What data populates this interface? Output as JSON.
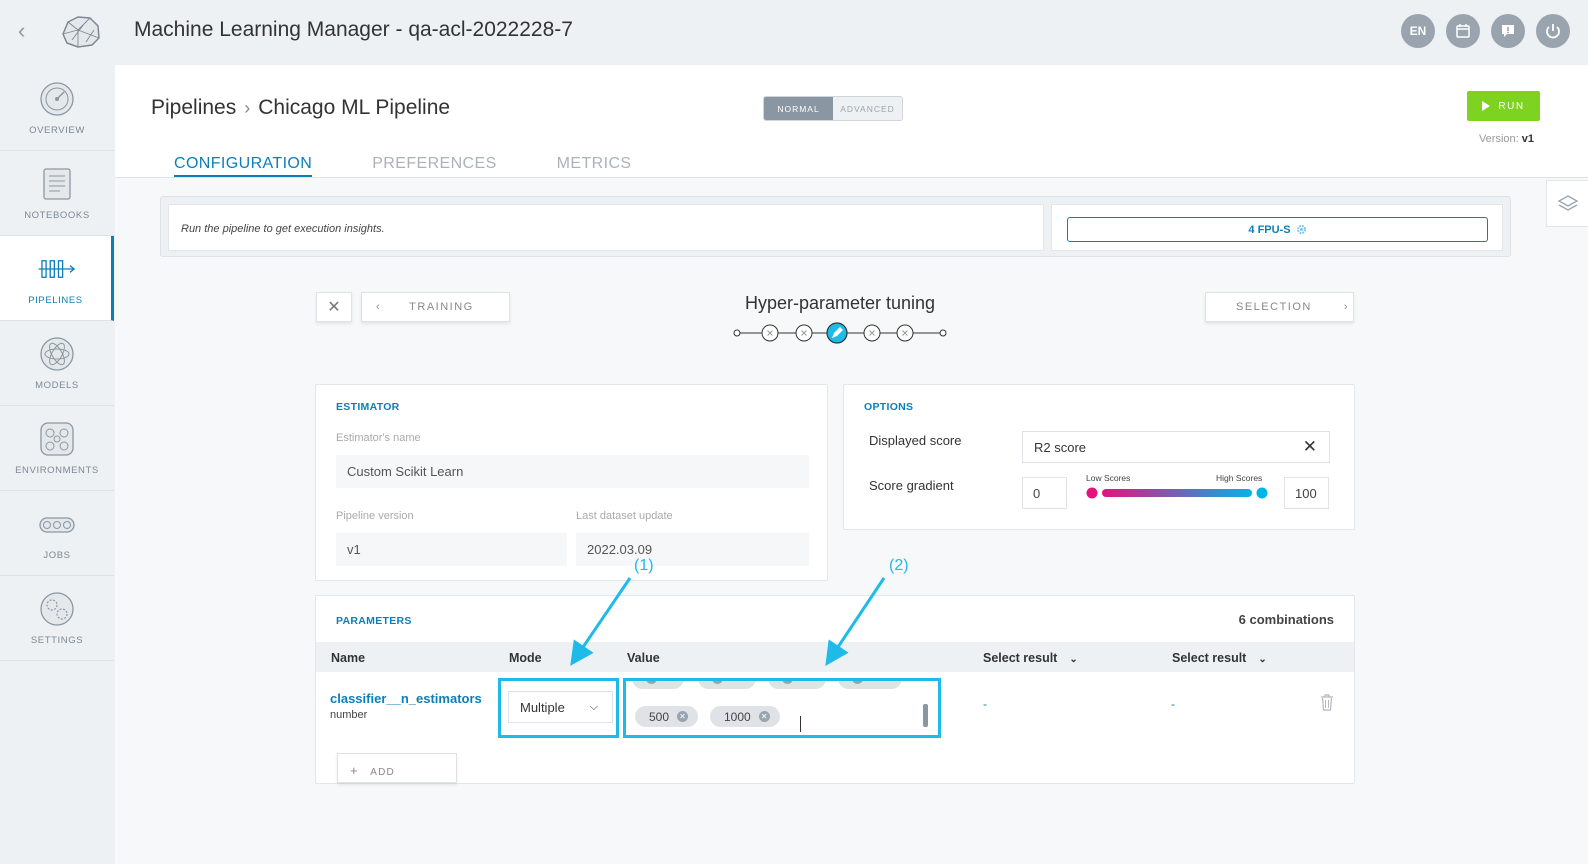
{
  "app": {
    "title": "Machine Learning Manager - qa-acl-2022228-7",
    "lang": "EN"
  },
  "sidebar": {
    "items": [
      {
        "label": "OVERVIEW",
        "icon": "gauge-icon"
      },
      {
        "label": "NOTEBOOKS",
        "icon": "notebook-icon"
      },
      {
        "label": "PIPELINES",
        "icon": "pipeline-icon",
        "active": true
      },
      {
        "label": "MODELS",
        "icon": "atom-icon"
      },
      {
        "label": "ENVIRONMENTS",
        "icon": "network-icon"
      },
      {
        "label": "JOBS",
        "icon": "conveyor-icon"
      },
      {
        "label": "SETTINGS",
        "icon": "gears-icon"
      }
    ]
  },
  "header": {
    "breadcrumb_root": "Pipelines",
    "breadcrumb_current": "Chicago ML Pipeline",
    "mode_normal": "NORMAL",
    "mode_advanced": "ADVANCED",
    "run_label": "RUN",
    "version_label": "Version:",
    "version_value": "v1",
    "tabs": [
      "CONFIGURATION",
      "PREFERENCES",
      "METRICS"
    ]
  },
  "infobar": {
    "message": "Run the pipeline to get execution insights.",
    "fpu": "4 FPU-S"
  },
  "stepper": {
    "prev_label": "TRAINING",
    "title": "Hyper-parameter tuning",
    "next_label": "SELECTION",
    "steps_total": 5,
    "active_step": 3
  },
  "estimator": {
    "title": "ESTIMATOR",
    "name_label": "Estimator's name",
    "name_value": "Custom Scikit Learn",
    "pipeline_version_label": "Pipeline version",
    "pipeline_version_value": "v1",
    "last_update_label": "Last dataset update",
    "last_update_value": "2022.03.09"
  },
  "options": {
    "title": "OPTIONS",
    "displayed_score_label": "Displayed score",
    "displayed_score_value": "R2 score",
    "gradient_label": "Score gradient",
    "gradient_min": "0",
    "gradient_max": "100",
    "low_label": "Low Scores",
    "high_label": "High Scores",
    "gradient_colors": [
      "#e5127d",
      "#00b4e6"
    ]
  },
  "parameters": {
    "title": "PARAMETERS",
    "combinations": "6 combinations",
    "columns": {
      "name": "Name",
      "mode": "Mode",
      "value": "Value",
      "select1": "Select result",
      "select2": "Select result"
    },
    "row": {
      "name": "classifier__n_estimators",
      "type": "number",
      "mode": "Multiple",
      "values": [
        "500",
        "1000"
      ],
      "result1": "-",
      "result2": "-"
    },
    "add_label": "ADD"
  },
  "annotations": {
    "label1": "(1)",
    "label2": "(2)"
  },
  "colors": {
    "accent": "#0d7fb8",
    "run": "#7ed321",
    "annotation": "#1ebbe9"
  }
}
